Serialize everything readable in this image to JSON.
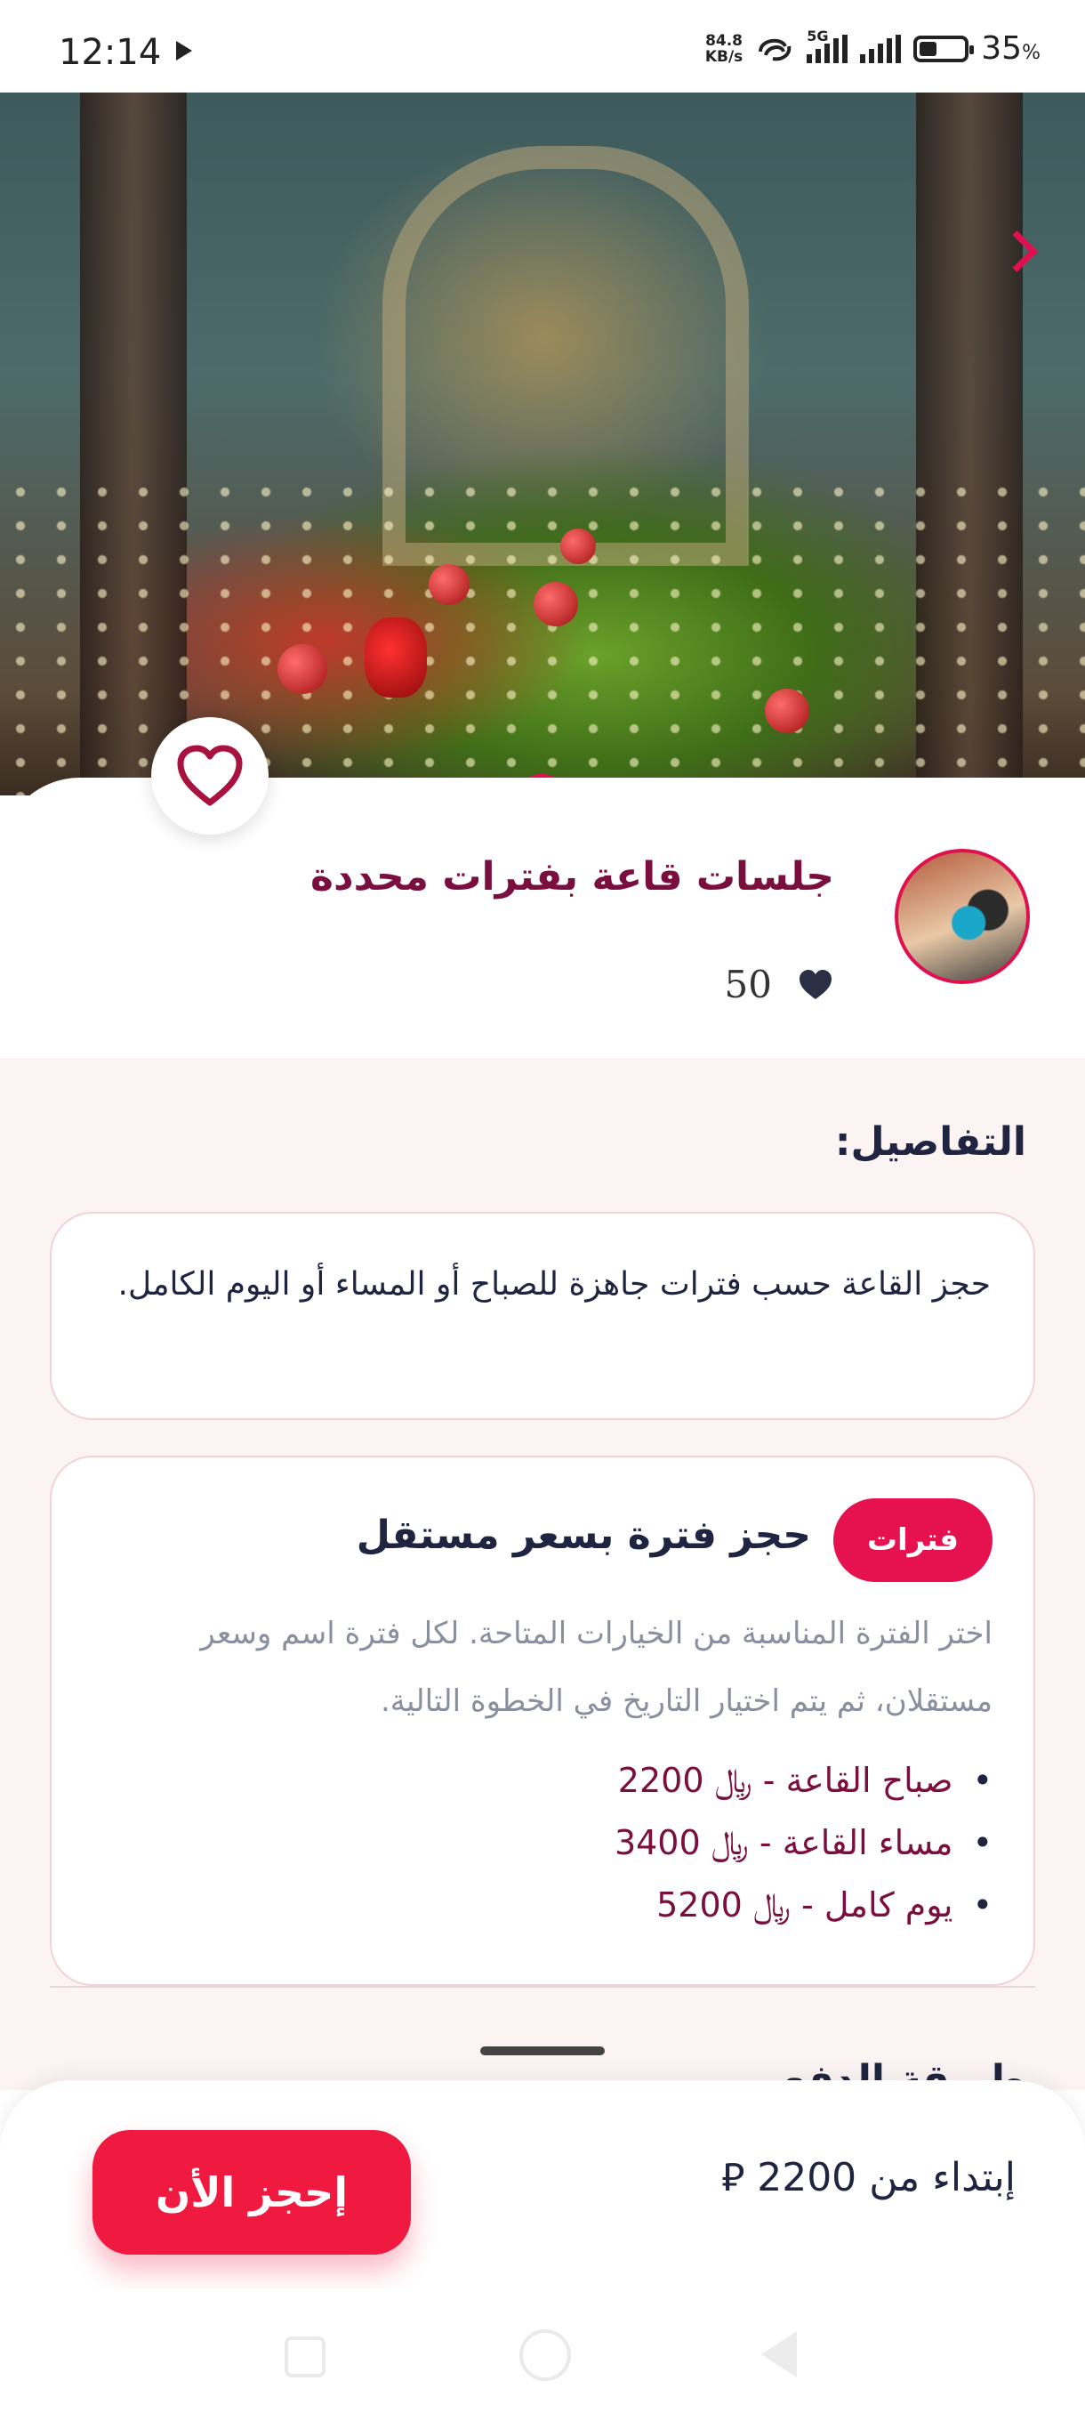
{
  "status_bar": {
    "time": "12:14",
    "net_speed_value": "84.8",
    "net_speed_unit": "KB/s",
    "network_type": "5G",
    "battery_percent": "35",
    "battery_suffix": "%"
  },
  "listing": {
    "title": "جلسات قاعة بفترات محددة",
    "likes": "50"
  },
  "details": {
    "heading": "التفاصيل:",
    "description": "حجز القاعة حسب فترات جاهزة للصباح أو المساء أو اليوم الكامل."
  },
  "periods": {
    "badge": "فترات",
    "title": "حجز فترة بسعر مستقل",
    "description": "اختر الفترة المناسبة من الخيارات المتاحة. لكل فترة اسم وسعر مستقلان، ثم يتم اختيار التاريخ في الخطوة التالية.",
    "items": [
      {
        "label": "صباح القاعة -",
        "currency": "﷼",
        "price": "2200"
      },
      {
        "label": "مساء القاعة -",
        "currency": "﷼",
        "price": "3400"
      },
      {
        "label": "يوم كامل -",
        "currency": "﷼",
        "price": "5200"
      }
    ]
  },
  "next_section": {
    "heading": "طريقة الدفع"
  },
  "booking": {
    "price_prefix": "إبتداء من",
    "price": "2200",
    "currency_symbol": "⃁",
    "book_button": "إحجز الأن"
  },
  "colors": {
    "accent": "#e6114f",
    "title": "#7a0f3f",
    "background_pink": "#fcf3f3"
  }
}
